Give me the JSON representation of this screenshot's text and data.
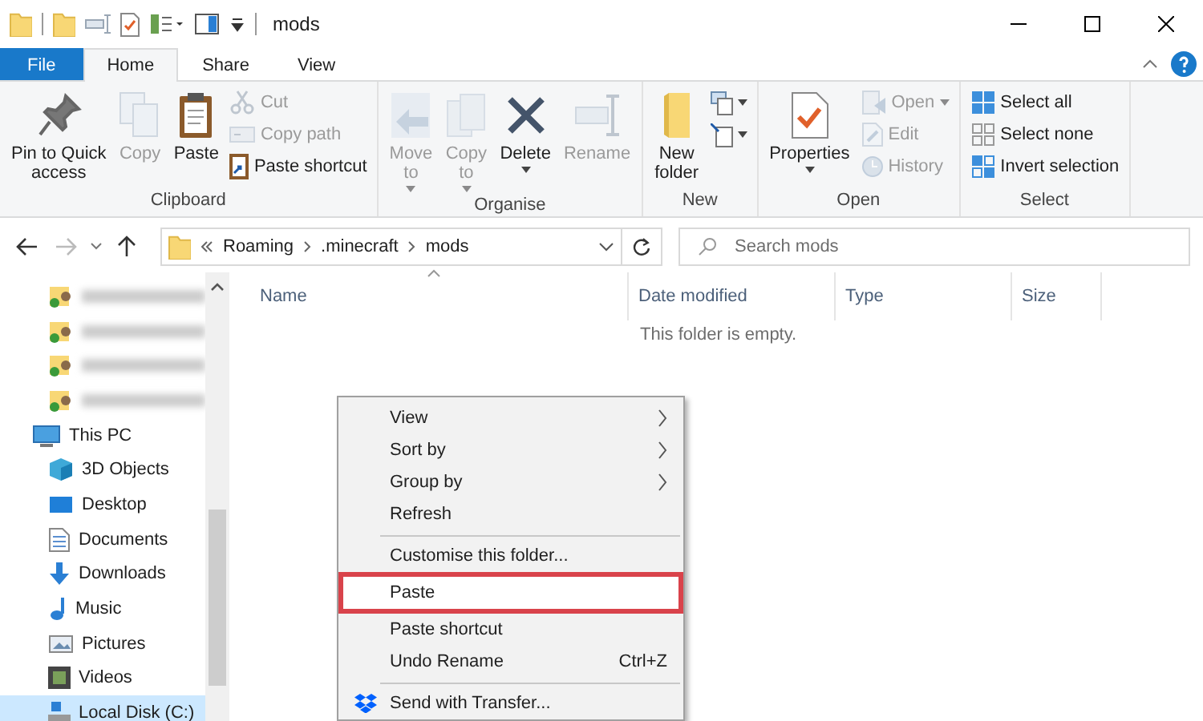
{
  "window": {
    "title": "mods"
  },
  "ribbon_tabs": [
    {
      "label": "File",
      "kind": "file",
      "selected": false
    },
    {
      "label": "Home",
      "kind": "tab",
      "selected": true
    },
    {
      "label": "Share",
      "kind": "tab",
      "selected": false
    },
    {
      "label": "View",
      "kind": "tab",
      "selected": false
    }
  ],
  "ribbon_groups": [
    {
      "label": "Clipboard",
      "items": [
        {
          "kind": "pin",
          "lines": [
            "Pin to Quick",
            "access"
          ],
          "disabled": false,
          "dropdown": false
        },
        {
          "kind": "copy",
          "lines": [
            "Copy"
          ],
          "disabled": true,
          "dropdown": false
        },
        {
          "kind": "paste",
          "lines": [
            "Paste"
          ],
          "disabled": false,
          "dropdown": false
        },
        {
          "kind": "stack",
          "items": [
            {
              "kind": "cut",
              "label": "Cut",
              "disabled": true,
              "dropdown": false
            },
            {
              "kind": "copypath",
              "label": "Copy path",
              "disabled": true,
              "dropdown": false
            },
            {
              "kind": "shortcut",
              "label": "Paste shortcut",
              "disabled": false,
              "dropdown": false
            }
          ]
        }
      ]
    },
    {
      "label": "Organise",
      "items": [
        {
          "kind": "move",
          "lines": [
            "Move",
            "to"
          ],
          "disabled": true,
          "dropdown": true
        },
        {
          "kind": "copyto",
          "lines": [
            "Copy",
            "to"
          ],
          "disabled": true,
          "dropdown": true
        },
        {
          "kind": "delete",
          "lines": [
            "Delete"
          ],
          "disabled": false,
          "dropdown": true
        },
        {
          "kind": "rename",
          "lines": [
            "Rename"
          ],
          "disabled": true,
          "dropdown": false
        }
      ]
    },
    {
      "label": "New",
      "items": [
        {
          "kind": "folder",
          "lines": [
            "New",
            "folder"
          ],
          "disabled": false,
          "dropdown": false
        },
        {
          "kind": "stack",
          "items": [
            {
              "kind": "newitem",
              "disabled": false,
              "dropdown": true
            },
            {
              "kind": "easyaccess",
              "disabled": false,
              "dropdown": true
            }
          ]
        }
      ]
    },
    {
      "label": "Open",
      "items": [
        {
          "kind": "properties",
          "lines": [
            "Properties"
          ],
          "disabled": false,
          "dropdown": true
        },
        {
          "kind": "stack",
          "items": [
            {
              "kind": "open",
              "label": "Open",
              "disabled": true,
              "dropdown": true
            },
            {
              "kind": "edit",
              "label": "Edit",
              "disabled": true,
              "dropdown": false
            },
            {
              "kind": "history",
              "label": "History",
              "disabled": true,
              "dropdown": false
            }
          ]
        }
      ]
    },
    {
      "label": "Select",
      "items": [
        {
          "kind": "stack",
          "items": [
            {
              "kind": "selectall",
              "label": "Select all",
              "disabled": false,
              "dropdown": false
            },
            {
              "kind": "selectnone",
              "label": "Select none",
              "disabled": false,
              "dropdown": false
            },
            {
              "kind": "invert",
              "label": "Invert selection",
              "disabled": false,
              "dropdown": false
            }
          ]
        }
      ]
    }
  ],
  "address": {
    "path": [
      "Roaming",
      ".minecraft",
      "mods"
    ]
  },
  "search": {
    "placeholder": "Search mods"
  },
  "nav": [
    {
      "kind": "blurred"
    },
    {
      "kind": "blurred"
    },
    {
      "kind": "blurred"
    },
    {
      "kind": "blurred"
    },
    {
      "kind": "this_pc",
      "label": "This PC",
      "selected": false,
      "children": [
        {
          "kind": "objects3d",
          "label": "3D Objects",
          "selected": false
        },
        {
          "kind": "desktop",
          "label": "Desktop",
          "selected": false
        },
        {
          "kind": "documents",
          "label": "Documents",
          "selected": false
        },
        {
          "kind": "downloads",
          "label": "Downloads",
          "selected": false
        },
        {
          "kind": "music",
          "label": "Music",
          "selected": false
        },
        {
          "kind": "pictures",
          "label": "Pictures",
          "selected": false
        },
        {
          "kind": "videos",
          "label": "Videos",
          "selected": false
        },
        {
          "kind": "disk",
          "label": "Local Disk (C:)",
          "selected": true
        }
      ]
    }
  ],
  "columns": [
    "Name",
    "Date modified",
    "Type",
    "Size"
  ],
  "empty_message": "This folder is empty.",
  "context_menu": [
    {
      "kind": "item",
      "label": "View",
      "submenu": true,
      "highlighted": false
    },
    {
      "kind": "item",
      "label": "Sort by",
      "submenu": true,
      "highlighted": false
    },
    {
      "kind": "item",
      "label": "Group by",
      "submenu": true,
      "highlighted": false
    },
    {
      "kind": "item",
      "label": "Refresh",
      "submenu": false,
      "highlighted": false
    },
    {
      "kind": "separator"
    },
    {
      "kind": "item",
      "label": "Customise this folder...",
      "submenu": false,
      "highlighted": false
    },
    {
      "kind": "item",
      "label": "Paste",
      "submenu": false,
      "highlighted": true
    },
    {
      "kind": "item",
      "label": "Paste shortcut",
      "submenu": false,
      "highlighted": false
    },
    {
      "kind": "item",
      "label": "Undo Rename",
      "shortcut": "Ctrl+Z",
      "submenu": false,
      "highlighted": false
    },
    {
      "kind": "separator"
    },
    {
      "kind": "transfer",
      "label": "Send with Transfer...",
      "submenu": false,
      "highlighted": false
    }
  ]
}
